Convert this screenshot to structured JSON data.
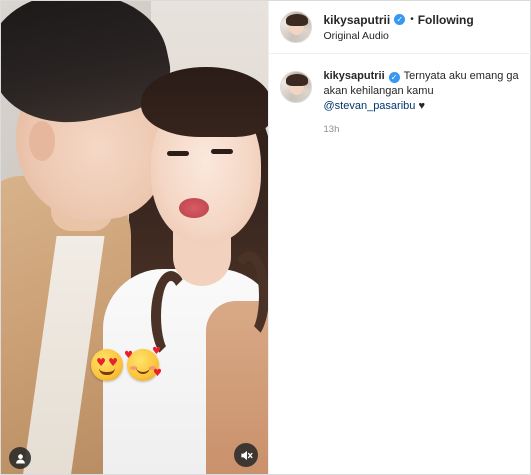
{
  "post": {
    "author": {
      "username": "kikysaputrii",
      "verified": true
    },
    "header": {
      "separator": "•",
      "follow_status": "Following",
      "audio": "Original Audio"
    },
    "caption": {
      "username": "kikysaputrii",
      "text": "Ternyata aku emang ga akan kehilangan kamu",
      "mention": "@stevan_pasaribu",
      "suffix": " ♥",
      "time": "13h"
    },
    "media": {
      "stickers": [
        "smiling-face-with-heart-eyes",
        "smiling-face-with-hearts"
      ],
      "controls": {
        "tagged_users_icon": "user-icon",
        "mute_icon": "speaker-muted-icon"
      }
    }
  }
}
